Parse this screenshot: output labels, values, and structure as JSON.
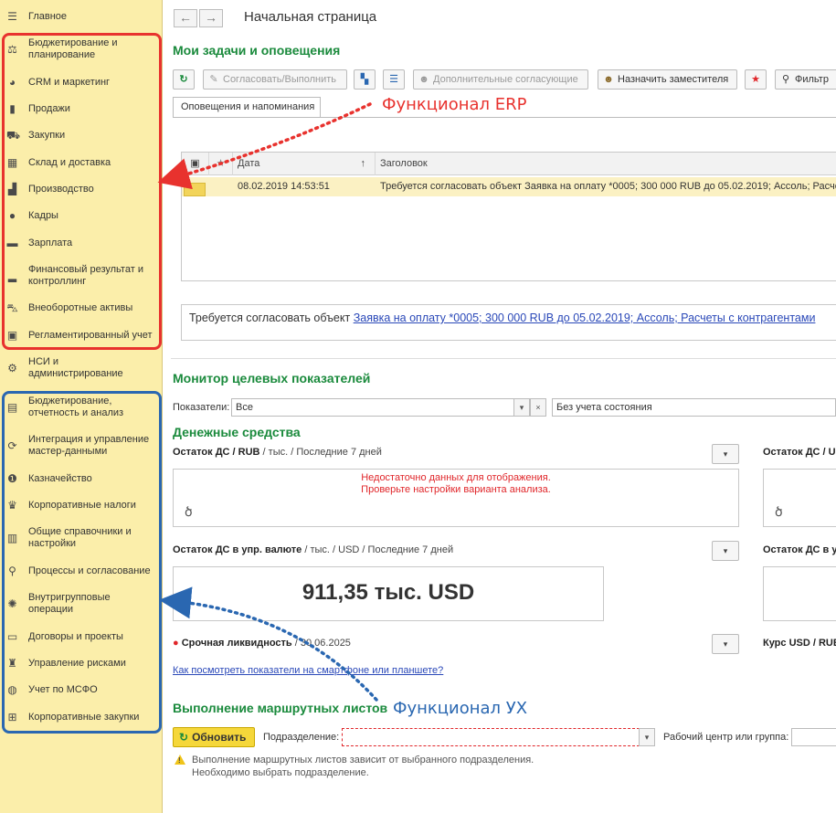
{
  "sidebar": {
    "items": [
      {
        "label": "Главное",
        "icon": "hamburger-icon"
      },
      {
        "label": "Бюджетирование и планирование",
        "icon": "budget-chart-icon"
      },
      {
        "label": "CRM и маркетинг",
        "icon": "pie-icon"
      },
      {
        "label": "Продажи",
        "icon": "bag-icon"
      },
      {
        "label": "Закупки",
        "icon": "cart-icon"
      },
      {
        "label": "Склад и доставка",
        "icon": "grid-icon"
      },
      {
        "label": "Производство",
        "icon": "factory-icon"
      },
      {
        "label": "Кадры",
        "icon": "person-icon"
      },
      {
        "label": "Зарплата",
        "icon": "wallet-icon"
      },
      {
        "label": "Финансовый результат и контроллинг",
        "icon": "bar-chart-icon"
      },
      {
        "label": "Внеоборотные активы",
        "icon": "truck-icon"
      },
      {
        "label": "Регламентированный учет",
        "icon": "calculator-icon"
      },
      {
        "label": "НСИ и администрирование",
        "icon": "gear-icon"
      },
      {
        "label": "Бюджетирование, отчетность и анализ",
        "icon": "report-icon"
      },
      {
        "label": "Интеграция и управление мастер-данными",
        "icon": "sync-icon"
      },
      {
        "label": "Казначейство",
        "icon": "coin-icon"
      },
      {
        "label": "Корпоративные налоги",
        "icon": "emblem-icon"
      },
      {
        "label": "Общие справочники и настройки",
        "icon": "book-icon"
      },
      {
        "label": "Процессы и согласование",
        "icon": "process-icon"
      },
      {
        "label": "Внутригрупповые операции",
        "icon": "atom-icon"
      },
      {
        "label": "Договоры и проекты",
        "icon": "briefcase-icon"
      },
      {
        "label": "Управление рисками",
        "icon": "extinguisher-icon"
      },
      {
        "label": "Учет по МСФО",
        "icon": "globe-icon"
      },
      {
        "label": "Корпоративные закупки",
        "icon": "gift-icon"
      }
    ]
  },
  "header": {
    "title": "Начальная страница",
    "back": "←",
    "forward": "→"
  },
  "tasks": {
    "title": "Мои задачи и оповещения",
    "toolbar": {
      "refresh": "↻",
      "approve": "Согласовать/Выполнить",
      "extra_approvers": "Дополнительные согласующие",
      "assign_deputy": "Назначить заместителя",
      "filter": "Фильтр"
    },
    "tab": "Оповещения и напоминания",
    "columns": {
      "date": "Дата",
      "sort": "↑",
      "header": "Заголовок"
    },
    "row": {
      "date": "08.02.2019 14:53:51",
      "header": "Требуется согласовать объект Заявка на оплату *0005; 300 000 RUB до 05.02.2019; Ассоль; Расче"
    },
    "message": {
      "prefix": "Требуется согласовать объект ",
      "link": "Заявка на оплату *0005; 300 000 RUB до 05.02.2019; Ассоль; Расчеты с контрагентами"
    }
  },
  "monitor": {
    "title": "Монитор целевых показателей",
    "indicators_label": "Показатели:",
    "indicators_value": "Все",
    "state_value": "Без учета состояния",
    "cash_title": "Денежные средства",
    "kpi1": {
      "name": "Остаток ДС / RUB",
      "detail": " / тыс. / Последние 7 дней"
    },
    "kpi1_right": "Остаток ДС / U",
    "no_data": "Недостаточно данных для отображения.",
    "check_settings": "Проверьте настройки варианта анализа.",
    "kpi2": {
      "name": "Остаток ДС в упр. валюте",
      "detail": " / тыс. / USD / Последние 7 дней"
    },
    "kpi2_right": "Остаток ДС в у",
    "kpi2_value": "911,35 тыс. USD",
    "kpi3": {
      "name": "Срочная ликвидность",
      "detail": " / 30.06.2025"
    },
    "kpi3_right": "Курс USD / RUB",
    "mobile_link": "Как посмотреть показатели на смартфоне или планшете?"
  },
  "route": {
    "title": "Выполнение маршрутных листов",
    "refresh": "Обновить",
    "division_label": "Подразделение:",
    "workcenter_label": "Рабочий центр или группа:",
    "warning1": "Выполнение маршрутных листов зависит от выбранного подразделения.",
    "warning2": "Необходимо выбрать подразделение."
  },
  "annotations": {
    "erp": "Функционал ERP",
    "ux": "Функционал УХ"
  },
  "colors": {
    "sidebar_bg": "#fbeeaa",
    "erp_frame": "#e8322e",
    "ux_frame": "#2a67b1",
    "section_title": "#1a8a3c",
    "link": "#2a48b8"
  }
}
